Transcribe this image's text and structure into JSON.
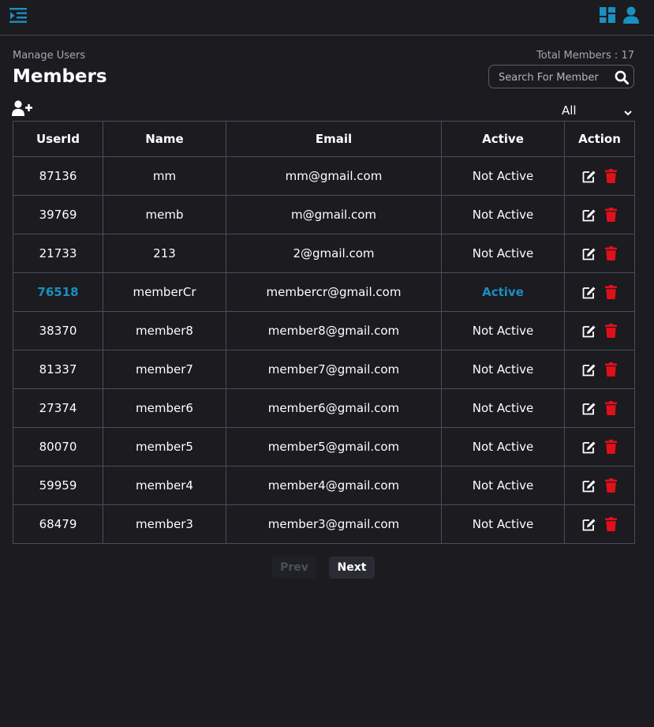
{
  "header": {
    "menu_icon": "menu-indent-icon",
    "dashboard_icon": "dashboard-grid-icon",
    "profile_icon": "user-icon",
    "accent_color": "#1b8fc0"
  },
  "page": {
    "breadcrumb": "Manage Users",
    "title": "Members",
    "total_members": "Total Members : 17"
  },
  "search": {
    "placeholder": "Search For Member",
    "value": ""
  },
  "filter": {
    "selected": "All"
  },
  "table": {
    "columns": [
      "UserId",
      "Name",
      "Email",
      "Active",
      "Action"
    ],
    "rows": [
      {
        "user_id": "87136",
        "name": "mm",
        "email": "mm@gmail.com",
        "status": "Not Active",
        "active": false
      },
      {
        "user_id": "39769",
        "name": "memb",
        "email": "m@gmail.com",
        "status": "Not Active",
        "active": false
      },
      {
        "user_id": "21733",
        "name": "213",
        "email": "2@gmail.com",
        "status": "Not Active",
        "active": false
      },
      {
        "user_id": "76518",
        "name": "memberCr",
        "email": "membercr@gmail.com",
        "status": "Active",
        "active": true
      },
      {
        "user_id": "38370",
        "name": "member8",
        "email": "member8@gmail.com",
        "status": "Not Active",
        "active": false
      },
      {
        "user_id": "81337",
        "name": "member7",
        "email": "member7@gmail.com",
        "status": "Not Active",
        "active": false
      },
      {
        "user_id": "27374",
        "name": "member6",
        "email": "member6@gmail.com",
        "status": "Not Active",
        "active": false
      },
      {
        "user_id": "80070",
        "name": "member5",
        "email": "member5@gmail.com",
        "status": "Not Active",
        "active": false
      },
      {
        "user_id": "59959",
        "name": "member4",
        "email": "member4@gmail.com",
        "status": "Not Active",
        "active": false
      },
      {
        "user_id": "68479",
        "name": "member3",
        "email": "member3@gmail.com",
        "status": "Not Active",
        "active": false
      }
    ]
  },
  "pagination": {
    "prev_label": "Prev",
    "next_label": "Next"
  },
  "colors": {
    "background": "#1b1b20",
    "inactive": "#e0101a",
    "active": "#1b8fc0",
    "delete": "#e0101a"
  }
}
